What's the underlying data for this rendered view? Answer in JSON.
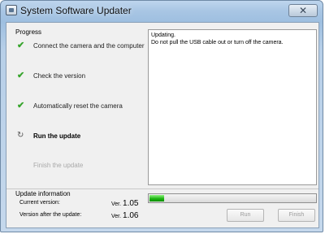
{
  "window": {
    "title": "System Software Updater",
    "close_glyph": "✕"
  },
  "progress": {
    "heading": "Progress",
    "steps": [
      {
        "label": "Connect the camera and the computer",
        "state": "done",
        "icon": "check-icon"
      },
      {
        "label": "Check the version",
        "state": "done",
        "icon": "check-icon"
      },
      {
        "label": "Automatically reset the camera",
        "state": "done",
        "icon": "check-icon"
      },
      {
        "label": "Run the update",
        "state": "active",
        "icon": "refresh-icon"
      },
      {
        "label": "Finish the update",
        "state": "disabled",
        "icon": ""
      }
    ],
    "check_glyph": "✔",
    "spin_glyph": "↻"
  },
  "log": {
    "lines": [
      "Updating.",
      "Do not pull the USB cable out or turn off the camera."
    ]
  },
  "update_info": {
    "heading": "Update information",
    "current_label": "Current version:",
    "current_prefix": "Ver.",
    "current_value": "1.05",
    "after_label": "Version after the update:",
    "after_prefix": "Ver.",
    "after_value": "1.06"
  },
  "progress_bar": {
    "fraction": 0.09,
    "color": "#19b10d"
  },
  "buttons": {
    "run_label": "Run",
    "finish_label": "Finish"
  }
}
